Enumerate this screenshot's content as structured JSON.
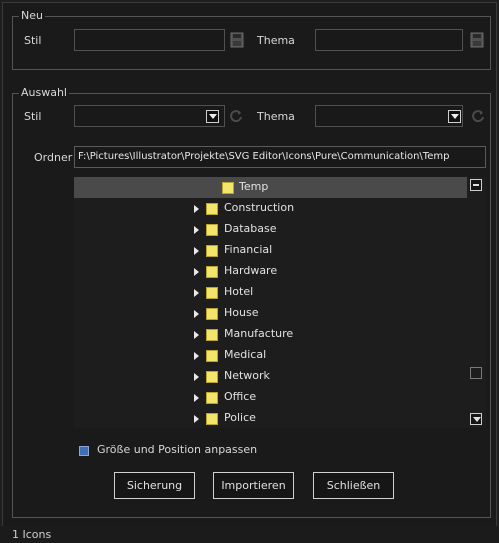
{
  "neu": {
    "legend": "Neu",
    "stil_label": "Stil",
    "thema_label": "Thema",
    "stil_value": "",
    "thema_value": ""
  },
  "auswahl": {
    "legend": "Auswahl",
    "stil_label": "Stil",
    "thema_label": "Thema",
    "stil_value": "",
    "thema_value": "",
    "ordner_label": "Ordner",
    "ordner_value": "F:\\Pictures\\Illustrator\\Projekte\\SVG Editor\\Icons\\Pure\\Communication\\Temp"
  },
  "tree": {
    "root": "Temp",
    "children": [
      "Construction",
      "Database",
      "Financial",
      "Hardware",
      "Hotel",
      "House",
      "Manufacture",
      "Medical",
      "Network",
      "Office",
      "Police"
    ]
  },
  "checkbox_label": "Größe und Position anpassen",
  "buttons": {
    "save": "Sicherung",
    "import": "Importieren",
    "close": "Schließen"
  },
  "status": "1 Icons",
  "colors": {
    "background": "#1a1a1a",
    "selection": "#4a4a4a",
    "folder": "#f5e46a",
    "checkbox": "#3f6fb5"
  }
}
